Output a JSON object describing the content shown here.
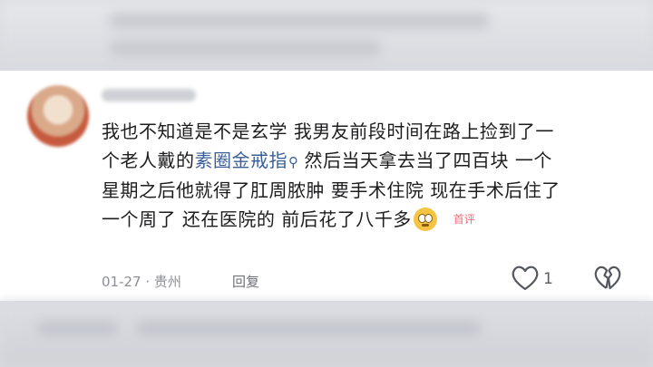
{
  "comment": {
    "username": "",
    "lines": {
      "l1": "我也不知道是不是玄学 我男友前段时间在路上捡到了一",
      "l2_before": "个老人戴的",
      "l2_link": "素圈金戒指",
      "l2_after": "然后当天拿去当了四百块 一个",
      "l3": "星期之后他就得了肛周脓肿 要手术住院 现在手术后住了",
      "l4": "一个周了 还在医院的 前后花了八千多"
    },
    "badge": "首评",
    "date": "01-27",
    "location": "贵州",
    "reply_label": "回复",
    "like_count": "1"
  },
  "icons": {
    "link": "search-icon",
    "like": "heart-outline-icon",
    "dislike": "broken-heart-icon",
    "emoji": "rolling-eyes-emoji-icon"
  },
  "colors": {
    "link": "#3a5f97",
    "badge": "#f26b7a",
    "meta": "#8d8f96"
  }
}
